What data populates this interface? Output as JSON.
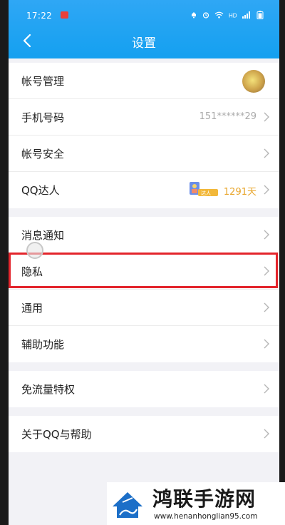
{
  "status_bar": {
    "time": "17:22",
    "badge": "REC"
  },
  "nav": {
    "title": "设置"
  },
  "groups": [
    {
      "items": [
        {
          "label": "帐号管理"
        },
        {
          "label": "手机号码",
          "value": "151******29"
        },
        {
          "label": "帐号安全"
        },
        {
          "label": "QQ达人",
          "badge_text": "达人",
          "days": "1291天"
        }
      ]
    },
    {
      "items": [
        {
          "label": "消息通知"
        },
        {
          "label": "隐私",
          "highlighted": true
        },
        {
          "label": "通用"
        },
        {
          "label": "辅助功能"
        }
      ]
    },
    {
      "items": [
        {
          "label": "免流量特权"
        }
      ]
    },
    {
      "items": [
        {
          "label": "关于QQ与帮助"
        }
      ]
    }
  ],
  "watermark": {
    "title": "鸿联手游网",
    "url": "www.henanhonglian95.com"
  },
  "colors": {
    "header": "#14a0f0",
    "highlight": "#e3242b",
    "days": "#e8a52a"
  }
}
